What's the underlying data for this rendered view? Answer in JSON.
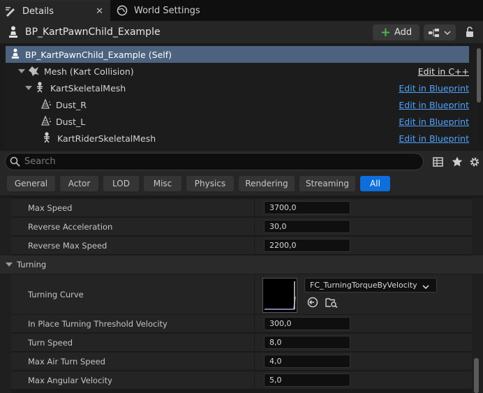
{
  "tabs": [
    {
      "label": "Details",
      "icon": "details-icon",
      "active": true
    },
    {
      "label": "World Settings",
      "icon": "globe-icon",
      "active": false
    }
  ],
  "header": {
    "title": "BP_KartPawnChild_Example",
    "add_label": "Add"
  },
  "tree": {
    "rows": [
      {
        "label": "BP_KartPawnChild_Example (Self)",
        "icon": "pawn-icon",
        "link": ""
      },
      {
        "label": "Mesh (Kart Collision)",
        "icon": "mesh-icon",
        "link": "Edit in C++"
      },
      {
        "label": "KartSkeletalMesh",
        "icon": "skeleton-icon",
        "link": "Edit in Blueprint"
      },
      {
        "label": "Dust_R",
        "icon": "particle-icon",
        "link": "Edit in Blueprint"
      },
      {
        "label": "Dust_L",
        "icon": "particle-icon",
        "link": "Edit in Blueprint"
      },
      {
        "label": "KartRiderSkeletalMesh",
        "icon": "skeleton-icon",
        "link": "Edit in Blueprint"
      }
    ]
  },
  "search": {
    "placeholder": "Search"
  },
  "filters": [
    "General",
    "Actor",
    "LOD",
    "Misc",
    "Physics",
    "Rendering",
    "Streaming",
    "All"
  ],
  "active_filter": "All",
  "properties": {
    "top": [
      {
        "name": "Max Speed",
        "value": "3700,0"
      },
      {
        "name": "Reverse Acceleration",
        "value": "30,0"
      },
      {
        "name": "Reverse Max Speed",
        "value": "2200,0"
      }
    ],
    "turning_category": "Turning",
    "turning_curve": {
      "name": "Turning Curve",
      "value": "FC_TurningTorqueByVelocity"
    },
    "turning": [
      {
        "name": "In Place Turning Threshold Velocity",
        "value": "300,0"
      },
      {
        "name": "Turn Speed",
        "value": "8,0"
      },
      {
        "name": "Max Air Turn Speed",
        "value": "4,0"
      },
      {
        "name": "Max Angular Velocity",
        "value": "5,0"
      }
    ]
  },
  "colors": {
    "accent": "#0d6edc",
    "selection": "#4c627f",
    "link": "#4ea2ff",
    "add": "#4cb34c"
  }
}
